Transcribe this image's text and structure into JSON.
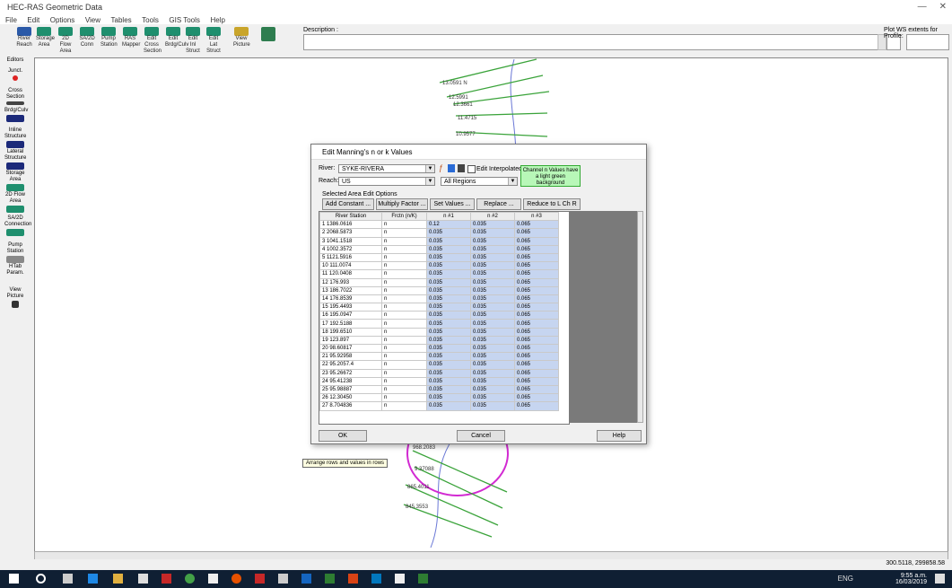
{
  "window": {
    "title": "HEC-RAS Geometric Data"
  },
  "menu": [
    "File",
    "Edit",
    "Options",
    "View",
    "Tables",
    "Tools",
    "GIS Tools",
    "Help"
  ],
  "toolbar": {
    "buttons": [
      {
        "label": "River Reach"
      },
      {
        "label": "Storage Area"
      },
      {
        "label": "2D Flow Area"
      },
      {
        "label": "SA/2D Conn"
      },
      {
        "label": "Pump Station"
      },
      {
        "label": "RAS Mapper"
      },
      {
        "label": "Edit Cross Section"
      },
      {
        "label": "Edit Brdg/Culv"
      },
      {
        "label": "Edit Inl Struct"
      },
      {
        "label": "Edit Lat Struct"
      },
      {
        "label": "View Picture"
      }
    ],
    "description_label": "Description :",
    "profile_label": "Plot WS extents for Profile:"
  },
  "left_tools": [
    "Editors",
    "Junct.",
    "Cross Section",
    "Brdg/Culv",
    "Inline Structure",
    "Lateral Structure",
    "Storage Area",
    "2D Flow Area",
    "SA/2D Connection",
    "Pump Station",
    "HTab Param.",
    "View Picture"
  ],
  "map_labels": {
    "upper": [
      "13.0591 N",
      "12.5991",
      "12.3661",
      "11.4715",
      "10.9577"
    ],
    "lower": [
      "968.2083",
      "9.37088",
      "865.4011",
      "845.3553"
    ]
  },
  "dialog": {
    "title": "Edit Manning's n or k Values",
    "river_label": "River:",
    "river_value": "SYKE-RIVERA",
    "reach_label": "Reach:",
    "reach_value": "US",
    "all_regions": "All Regions",
    "edit_interpolated": "Edit Interpolated XS's",
    "hint": "Channel n Values have a light green background",
    "selected_area_label": "Selected Area Edit Options",
    "buttons": [
      "Add Constant ...",
      "Multiply Factor ...",
      "Set Values ...",
      "Replace ...",
      "Reduce to L Ch R ..."
    ],
    "columns": [
      "River Station",
      "Frctn (n/K)",
      "n #1",
      "n #2",
      "n #3"
    ],
    "rows": [
      [
        "1 1386.0616",
        "n",
        "0.12",
        "0.035",
        "0.065"
      ],
      [
        "2 2068.5873",
        "n",
        "0.035",
        "0.035",
        "0.065"
      ],
      [
        "3 1041.1518",
        "n",
        "0.035",
        "0.035",
        "0.065"
      ],
      [
        "4 1002.3572",
        "n",
        "0.035",
        "0.035",
        "0.065"
      ],
      [
        "5 1121.5916",
        "n",
        "0.035",
        "0.035",
        "0.065"
      ],
      [
        "10 111.0074",
        "n",
        "0.035",
        "0.035",
        "0.065"
      ],
      [
        "11 120.0408",
        "n",
        "0.035",
        "0.035",
        "0.065"
      ],
      [
        "12 176.993",
        "n",
        "0.035",
        "0.035",
        "0.065"
      ],
      [
        "13 186.7022",
        "n",
        "0.035",
        "0.035",
        "0.065"
      ],
      [
        "14 176.8539",
        "n",
        "0.035",
        "0.035",
        "0.065"
      ],
      [
        "15 195.4493",
        "n",
        "0.035",
        "0.035",
        "0.065"
      ],
      [
        "16 195.0947",
        "n",
        "0.035",
        "0.035",
        "0.065"
      ],
      [
        "17 192.5188",
        "n",
        "0.035",
        "0.035",
        "0.065"
      ],
      [
        "18 199.6510",
        "n",
        "0.035",
        "0.035",
        "0.065"
      ],
      [
        "19 123.897",
        "n",
        "0.035",
        "0.035",
        "0.065"
      ],
      [
        "20 98.60817",
        "n",
        "0.035",
        "0.035",
        "0.065"
      ],
      [
        "21 95.92958",
        "n",
        "0.035",
        "0.035",
        "0.065"
      ],
      [
        "22 95.2057.4",
        "n",
        "0.035",
        "0.035",
        "0.065"
      ],
      [
        "23 95.26672",
        "n",
        "0.035",
        "0.035",
        "0.065"
      ],
      [
        "24 95.41238",
        "n",
        "0.035",
        "0.035",
        "0.065"
      ],
      [
        "25 95.98887",
        "n",
        "0.035",
        "0.035",
        "0.065"
      ],
      [
        "26 12.30450",
        "n",
        "0.035",
        "0.035",
        "0.065"
      ],
      [
        "27 8.704836",
        "n",
        "0.035",
        "0.035",
        "0.065"
      ]
    ],
    "ok": "OK",
    "cancel": "Cancel",
    "help": "Help"
  },
  "tooltip": "Arrange rows and values in rows",
  "status": {
    "text": "300.5118, 299858.58"
  },
  "taskbar": {
    "tray": "ENG",
    "time": "9:55 a.m.",
    "date": "16/03/2019"
  }
}
